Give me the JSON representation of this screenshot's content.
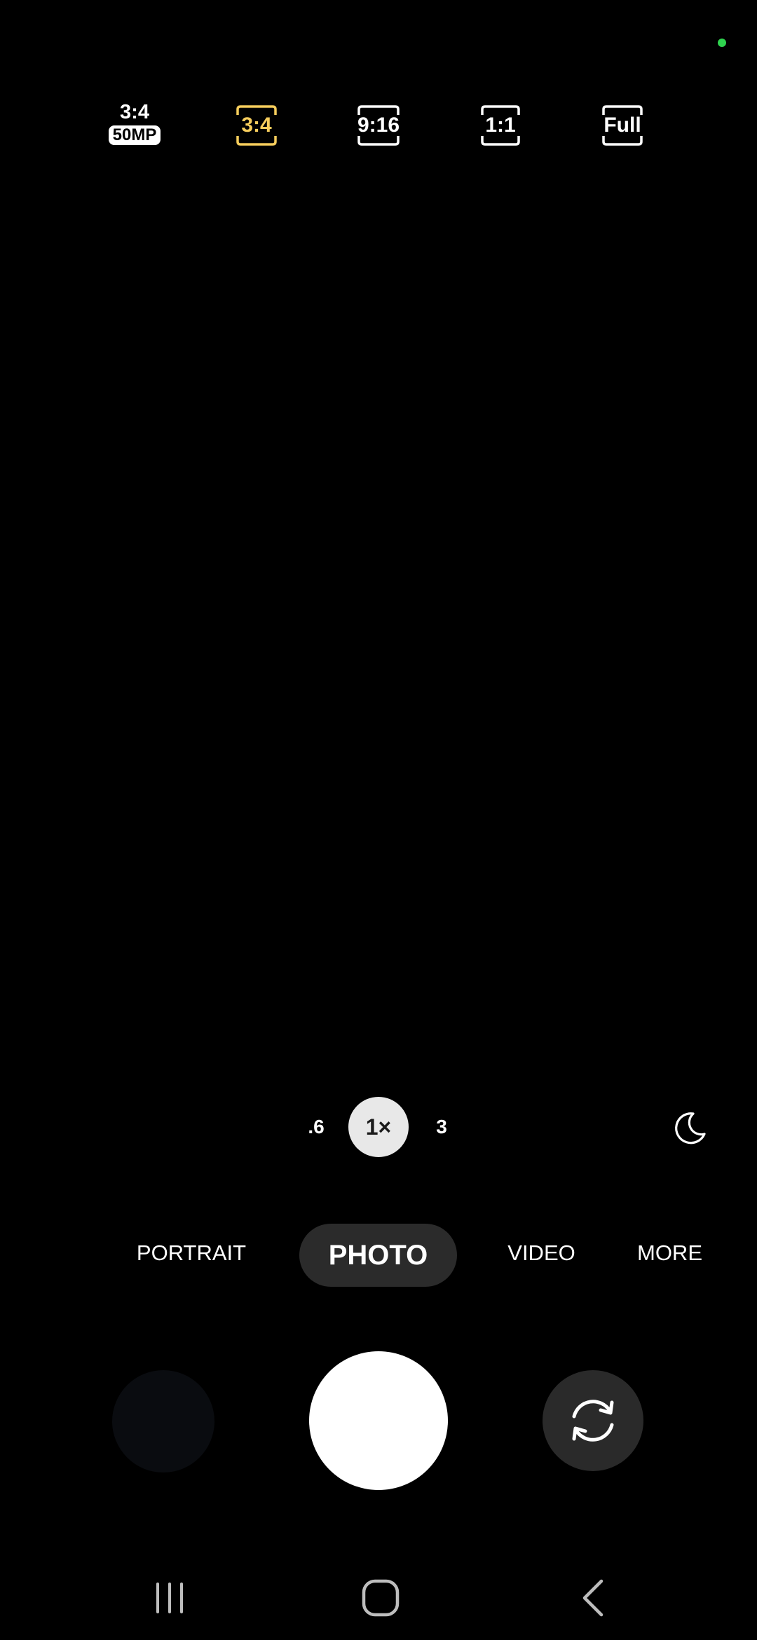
{
  "status": {
    "privacy_indicator_color": "#2fd34f"
  },
  "aspect_ratios": {
    "ratio_50mp": {
      "top": "3:4",
      "badge": "50MP"
    },
    "ratio_3_4": {
      "label": "3:4",
      "selected": true,
      "accent": "#f6cd5c"
    },
    "ratio_9_16": {
      "label": "9:16"
    },
    "ratio_1_1": {
      "label": "1:1"
    },
    "ratio_full": {
      "label": "Full"
    }
  },
  "zoom": {
    "ultra_wide": ".6",
    "wide": "1×",
    "tele": "3",
    "selected": "1×"
  },
  "night_mode_icon": "moon-icon",
  "modes": {
    "portrait": "PORTRAIT",
    "photo": "PHOTO",
    "video": "VIDEO",
    "more": "MORE",
    "selected": "PHOTO"
  },
  "controls": {
    "gallery_icon": "gallery-thumbnail",
    "shutter_icon": "shutter-button",
    "switch_icon": "switch-camera-icon"
  },
  "navigation": {
    "recents_icon": "recents-icon",
    "home_icon": "home-icon",
    "back_icon": "back-icon"
  }
}
